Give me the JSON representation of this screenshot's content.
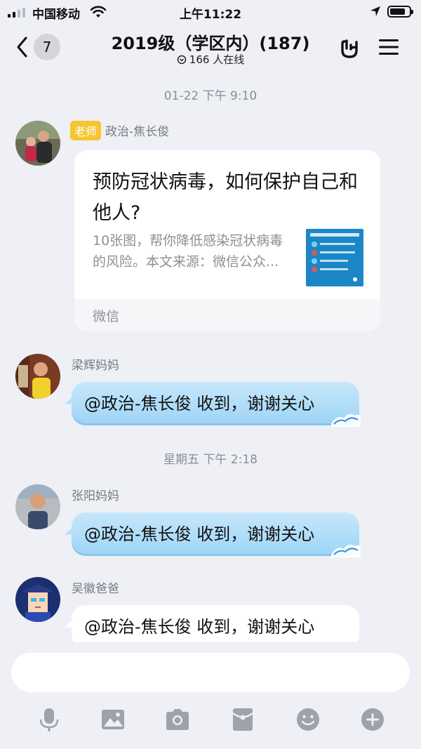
{
  "status_bar": {
    "carrier": "中国移动",
    "time": "上午11:22"
  },
  "header": {
    "back_count": "7",
    "title": "2019级（学区内）(187)",
    "online": "166 人在线"
  },
  "messages": {
    "ts1": "01-22 下午 9:10",
    "m1": {
      "tag": "老师",
      "sender": "政治-焦长俊",
      "card_title": "预防冠状病毒，如何保护自己和他人?",
      "card_desc_line1": "10张图，帮你降低感染冠状病毒",
      "card_desc_line2": "的风险。本文来源：微信公众...",
      "card_source": "微信"
    },
    "m2": {
      "sender": "梁辉妈妈",
      "text": "@政治-焦长俊 收到，谢谢关心"
    },
    "ts2": "星期五 下午 2:18",
    "m3": {
      "sender": "张阳妈妈",
      "text": "@政治-焦长俊 收到，谢谢关心"
    },
    "m4": {
      "sender": "吴徽爸爸",
      "text": "@政治-焦长俊 收到，谢谢关心"
    }
  },
  "input": {
    "placeholder": ""
  },
  "toolbar": [
    "microphone-icon",
    "image-icon",
    "camera-icon",
    "red-packet-icon",
    "emoji-icon",
    "plus-icon"
  ],
  "colors": {
    "background": "#eef0f6",
    "bubble": "#a9daf8",
    "teacher_tag": "#f5c531"
  }
}
